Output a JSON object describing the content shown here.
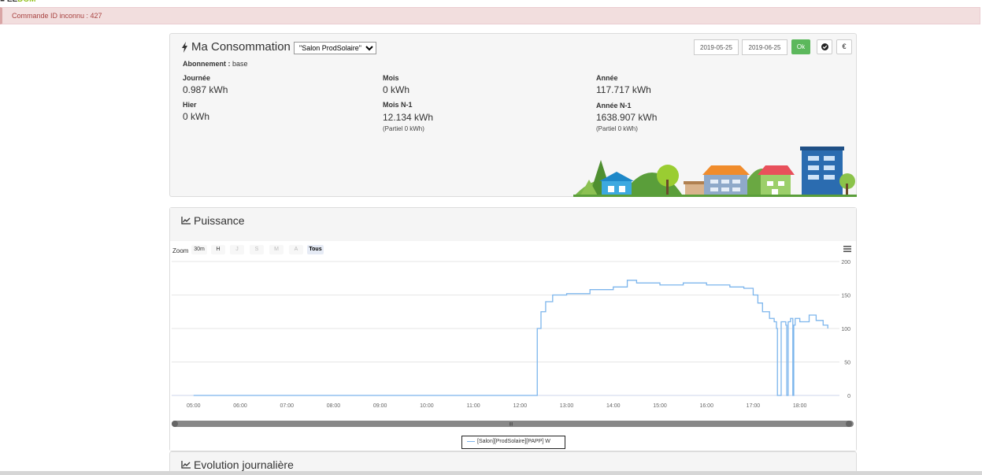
{
  "alert": {
    "text": "Commande ID inconnu : 427"
  },
  "consommation": {
    "title": "Ma Consommation",
    "select_value": "\"Salon ProdSolaire\"",
    "date_from": "2019-05-25",
    "date_to": "2019-06-25",
    "ok_label": "Ok",
    "euro_label": "€",
    "abonnement_label": "Abonnement :",
    "abonnement_value": "base",
    "journee_label": "Journée",
    "journee_value": "0.987 kWh",
    "hier_label": "Hier",
    "hier_value": "0 kWh",
    "mois_label": "Mois",
    "mois_value": "0 kWh",
    "mois_n1_label": "Mois N-1",
    "mois_n1_value": "12.134 kWh",
    "mois_n1_partiel": "(Partiel 0 kWh)",
    "annee_label": "Année",
    "annee_value": "117.717 kWh",
    "annee_n1_label": "Année N-1",
    "annee_n1_value": "1638.907 kWh",
    "annee_n1_partiel": "(Partiel 0 kWh)"
  },
  "puissance": {
    "title": "Puissance",
    "zoom_label": "Zoom",
    "zoom_buttons": [
      "30m",
      "H",
      "J",
      "S",
      "M",
      "A",
      "Tous"
    ],
    "scroll_grip": "III",
    "legend": "[Salon][ProdSolaire][PAPP] W"
  },
  "evolution": {
    "title": "Evolution journalière"
  },
  "chart_data": {
    "type": "line",
    "series": [
      {
        "name": "[Salon][ProdSolaire][PAPP] W",
        "color": "#7cb5ec"
      }
    ],
    "x_ticks": [
      "05:00",
      "06:00",
      "07:00",
      "08:00",
      "09:00",
      "10:00",
      "11:00",
      "12:00",
      "13:00",
      "14:00",
      "15:00",
      "16:00",
      "17:00",
      "18:00"
    ],
    "y_ticks": [
      0,
      50,
      100,
      150,
      200
    ],
    "ylim": [
      0,
      200
    ],
    "x_hours": [
      5.0,
      12.35,
      12.37,
      12.45,
      12.55,
      12.7,
      12.85,
      13.0,
      13.5,
      14.0,
      14.3,
      14.5,
      15.0,
      15.5,
      16.0,
      16.5,
      16.8,
      17.0,
      17.1,
      17.2,
      17.35,
      17.45,
      17.5,
      17.52,
      17.55,
      17.6,
      17.7,
      17.72,
      17.75,
      17.8,
      17.85,
      17.87,
      17.9,
      18.0,
      18.2,
      18.35,
      18.5,
      18.6
    ],
    "y_values": [
      0,
      0,
      100,
      125,
      140,
      150,
      150,
      152,
      158,
      162,
      172,
      168,
      165,
      168,
      165,
      162,
      160,
      150,
      138,
      125,
      115,
      110,
      100,
      0,
      0,
      110,
      105,
      0,
      110,
      115,
      0,
      105,
      115,
      110,
      120,
      112,
      105,
      100
    ]
  }
}
